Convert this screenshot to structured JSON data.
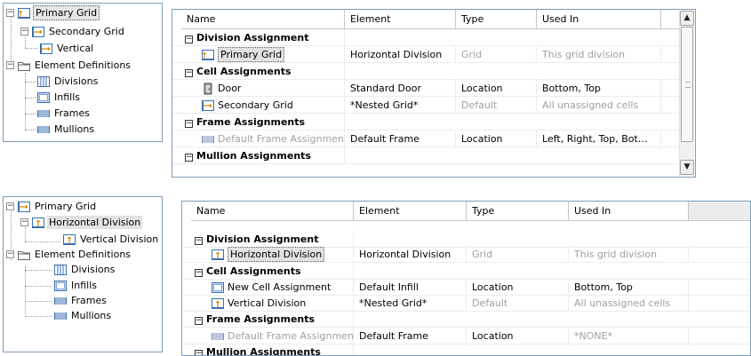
{
  "top": {
    "tree": [
      {
        "label": "Primary Grid",
        "icon": "grid-icon",
        "selected": true
      },
      {
        "label": "Secondary Grid",
        "icon": "grid-horizontal-icon"
      },
      {
        "label": "Vertical",
        "icon": "grid-horizontal-icon"
      },
      {
        "label": "Element Definitions",
        "icon": "folder-icon"
      },
      {
        "label": "Divisions",
        "icon": "divisions-icon"
      },
      {
        "label": "Infills",
        "icon": "infills-icon"
      },
      {
        "label": "Frames",
        "icon": "frames-icon"
      },
      {
        "label": "Mullions",
        "icon": "mullions-icon"
      }
    ],
    "columns": [
      "Name",
      "Element",
      "Type",
      "Used In"
    ],
    "rows": [
      {
        "group": "Division Assignment"
      },
      {
        "name": "Primary Grid",
        "icon": "grid-icon",
        "selected": true,
        "element": "Horizontal Division",
        "type": "Grid",
        "used_in": "This grid division",
        "type_dim": true,
        "used_dim": true
      },
      {
        "group": "Cell Assignments"
      },
      {
        "name": "Door",
        "icon": "door-icon",
        "element": "Standard Door",
        "type": "Location",
        "used_in": "Bottom, Top"
      },
      {
        "name": "Secondary Grid",
        "icon": "grid-horizontal-icon",
        "element": "*Nested Grid*",
        "type": "Default",
        "used_in": "All unassigned cells",
        "type_dim": true,
        "used_dim": true
      },
      {
        "group": "Frame Assignments"
      },
      {
        "name": "Default Frame Assignment",
        "icon": "frames-icon",
        "name_dim": true,
        "element": "Default Frame",
        "type": "Location",
        "used_in": "Left, Right, Top, Bot…"
      },
      {
        "group": "Mullion Assignments"
      }
    ]
  },
  "bottom": {
    "tree": [
      {
        "label": "Primary Grid",
        "icon": "grid-horizontal-icon"
      },
      {
        "label": "Horizontal Division",
        "icon": "grid-icon",
        "selected": true
      },
      {
        "label": "Vertical Division",
        "icon": "grid-icon"
      },
      {
        "label": "Element Definitions",
        "icon": "folder-icon"
      },
      {
        "label": "Divisions",
        "icon": "divisions-icon"
      },
      {
        "label": "Infills",
        "icon": "infills-icon"
      },
      {
        "label": "Frames",
        "icon": "frames-icon"
      },
      {
        "label": "Mullions",
        "icon": "mullions-icon"
      }
    ],
    "columns": [
      "Name",
      "Element",
      "Type",
      "Used In"
    ],
    "rows": [
      {
        "group": "Division Assignment"
      },
      {
        "name": "Horizontal Division",
        "icon": "grid-icon",
        "selected": true,
        "element": "Horizontal Division",
        "type": "Grid",
        "used_in": "This grid division",
        "type_dim": true,
        "used_dim": true
      },
      {
        "group": "Cell Assignments"
      },
      {
        "name": "New Cell Assignment",
        "icon": "infills-icon",
        "element": "Default Infill",
        "type": "Location",
        "used_in": "Bottom, Top"
      },
      {
        "name": "Vertical Division",
        "icon": "grid-icon",
        "element": "*Nested Grid*",
        "type": "Default",
        "used_in": "All unassigned cells",
        "type_dim": true,
        "used_dim": true
      },
      {
        "group": "Frame Assignments"
      },
      {
        "name": "Default Frame Assignment",
        "icon": "frames-icon",
        "name_dim": true,
        "element": "Default Frame",
        "type": "Location",
        "used_in": "*NONE*",
        "used_dim": true
      },
      {
        "group": "Mullion Assignments"
      }
    ]
  }
}
